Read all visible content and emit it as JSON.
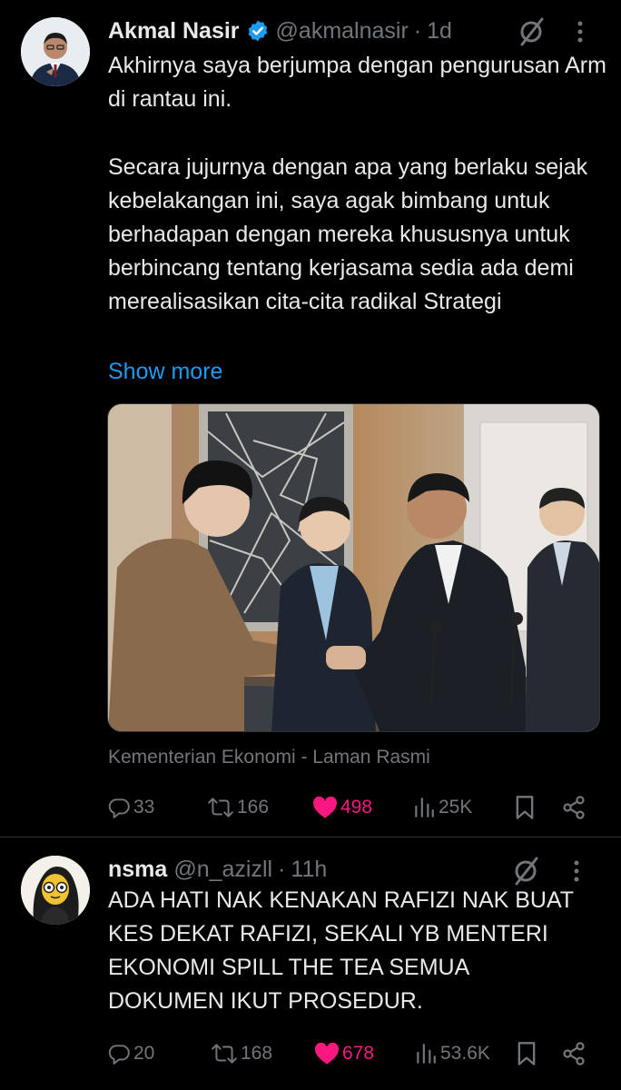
{
  "tweets": [
    {
      "author_name": "Akmal Nasir",
      "author_handle": "@akmalnasir",
      "time": "1d",
      "text_p1": "Akhirnya saya berjumpa dengan pengurusan Arm di rantau ini.",
      "text_p2": "Secara jujurnya dengan apa yang berlaku sejak kebelakangan ini, saya agak bimbang untuk berhadapan dengan mereka khususnya untuk berbincang tentang kerjasama sedia ada demi merealisasikan cita-cita radikal Strategi",
      "show_more": "Show more",
      "image_caption": "Kementerian Ekonomi - Laman Rasmi",
      "replies": "33",
      "reposts": "166",
      "likes": "498",
      "views": "25K",
      "liked": true,
      "verified": true
    },
    {
      "author_name": "nsma",
      "author_handle": "@n_azizll",
      "time": "11h",
      "text": "ADA HATI NAK KENAKAN RAFIZI NAK BUAT KES DEKAT RAFIZI, SEKALI YB MENTERI EKONOMI SPILL THE TEA SEMUA DOKUMEN IKUT PROSEDUR.",
      "replies": "20",
      "reposts": "168",
      "likes": "678",
      "views": "53.6K",
      "liked": true
    }
  ],
  "icons": [
    "verified-badge-icon",
    "grok-icon",
    "more-options-icon",
    "reply-icon",
    "repost-icon",
    "like-icon",
    "views-icon",
    "bookmark-icon",
    "share-icon"
  ],
  "colors": {
    "background": "#000000",
    "text": "#e7e9ea",
    "muted": "#71767b",
    "link": "#1d9bf0",
    "like": "#f91880",
    "divider": "#2f3336"
  }
}
